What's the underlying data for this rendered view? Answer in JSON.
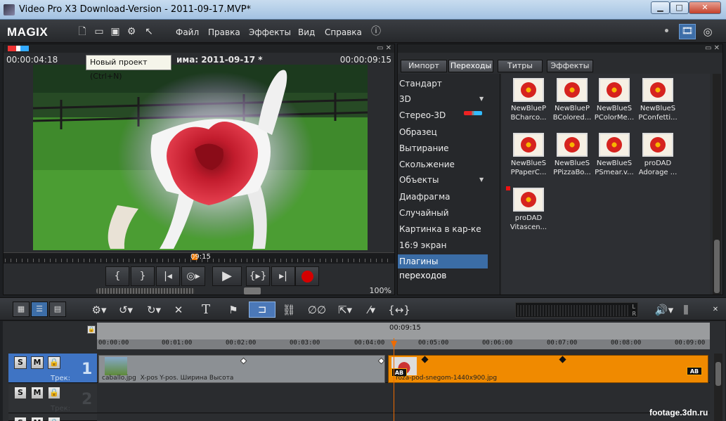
{
  "window": {
    "title": "Video Pro X3 Download-Version - 2011-09-17.MVP*"
  },
  "menu": {
    "logo": "MAGIX",
    "items": [
      "Файл",
      "Правка",
      "Эффекты",
      "Вид",
      "Справка"
    ]
  },
  "preview": {
    "timecode_left": "00:00:04:18",
    "timecode_right": "00:00:09:15",
    "title": "има: 2011-09-17 *",
    "tooltip": "Новый проект (Ctrl+N)",
    "scrub_time": "09:15",
    "zoom": "100%"
  },
  "media_panel": {
    "tabs": [
      "Импорт",
      "Переходы",
      "Титры",
      "Эффекты"
    ],
    "active_tab": "Переходы",
    "categories": [
      "Стандарт",
      "3D",
      "Стерео-3D",
      "Образец",
      "Вытирание",
      "Скольжение",
      "Объекты",
      "Диафрагма",
      "Случайный",
      "Картинка в кар-ке",
      "16:9 экран",
      "Плагины переходов"
    ],
    "selected_category": "Плагины переходов",
    "effects": [
      "NewBlueP\nBCharco...",
      "NewBlueP\nBColored...",
      "NewBlueS\nPColorMe...",
      "NewBlueS\nPConfetti...",
      "NewBlueS\nPPaperC...",
      "NewBlueS\nPPizzaBo...",
      "NewBlueS\nPSmear.v...",
      "proDAD\nAdorage ...",
      "proDAD\nVitascen..."
    ]
  },
  "timeline": {
    "ruler_label": "00:09:15",
    "ruler_ticks": [
      "00:00:00",
      "00:01:00",
      "00:02:00",
      "00:03:00",
      "00:04:00",
      "00:05:00",
      "00:06:00",
      "00:07:00",
      "00:08:00",
      "00:09:00"
    ],
    "tracks": [
      {
        "number": "1",
        "label": "Трек:"
      },
      {
        "number": "2",
        "label": "Трек:"
      }
    ],
    "clip1": {
      "name": "caballo.jpg",
      "params": "X-pos   Y-pos.   Ширина   Высота"
    },
    "clip2": {
      "name": "roza-pod-snegom-1440x900.jpg"
    },
    "ab_label": "AB"
  },
  "meter": {
    "lr": "L\nR"
  },
  "watermark": "footage.3dn.ru"
}
